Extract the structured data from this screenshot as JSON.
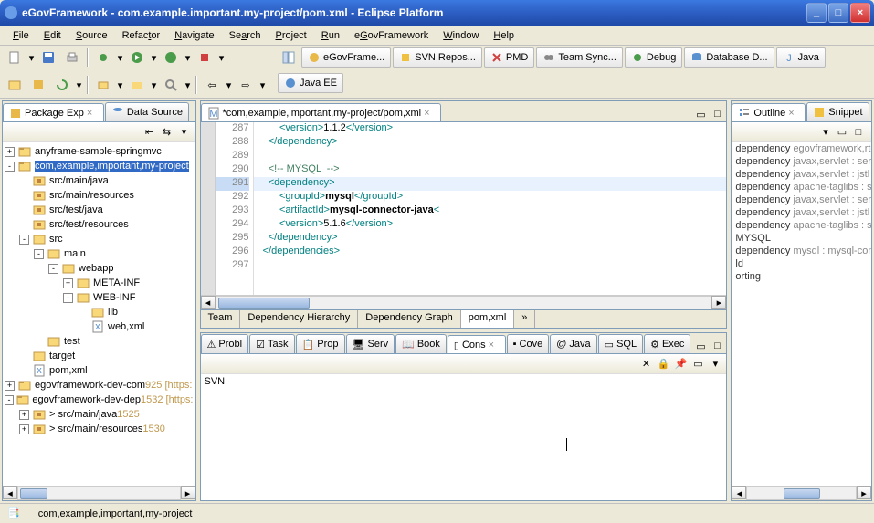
{
  "title": "eGovFramework - com.example.important.my-project/pom.xml - Eclipse Platform",
  "menu": [
    "File",
    "Edit",
    "Source",
    "Refactor",
    "Navigate",
    "Search",
    "Project",
    "Run",
    "eGovFramework",
    "Window",
    "Help"
  ],
  "perspectives": [
    "eGovFrame...",
    "SVN Repos...",
    "PMD",
    "Team Sync...",
    "Debug",
    "Database D...",
    "Java",
    "Java EE"
  ],
  "package_explorer": {
    "tab1": "Package Exp",
    "tab2": "Data Source",
    "tree": [
      {
        "indent": 0,
        "toggle": "+",
        "icon": "project",
        "label": "anyframe-sample-springmvc"
      },
      {
        "indent": 0,
        "toggle": "-",
        "icon": "project",
        "label": "com,example,important,my-project",
        "selected": true
      },
      {
        "indent": 1,
        "toggle": "",
        "icon": "pkg-folder",
        "label": "src/main/java"
      },
      {
        "indent": 1,
        "toggle": "",
        "icon": "pkg-folder",
        "label": "src/main/resources"
      },
      {
        "indent": 1,
        "toggle": "",
        "icon": "pkg-folder",
        "label": "src/test/java"
      },
      {
        "indent": 1,
        "toggle": "",
        "icon": "pkg-folder",
        "label": "src/test/resources"
      },
      {
        "indent": 1,
        "toggle": "-",
        "icon": "folder",
        "label": "src"
      },
      {
        "indent": 2,
        "toggle": "-",
        "icon": "folder",
        "label": "main"
      },
      {
        "indent": 3,
        "toggle": "-",
        "icon": "folder",
        "label": "webapp"
      },
      {
        "indent": 4,
        "toggle": "+",
        "icon": "folder",
        "label": "META-INF"
      },
      {
        "indent": 4,
        "toggle": "-",
        "icon": "folder",
        "label": "WEB-INF"
      },
      {
        "indent": 5,
        "toggle": "",
        "icon": "folder",
        "label": "lib"
      },
      {
        "indent": 5,
        "toggle": "",
        "icon": "xml",
        "label": "web,xml"
      },
      {
        "indent": 2,
        "toggle": "",
        "icon": "folder",
        "label": "test"
      },
      {
        "indent": 1,
        "toggle": "",
        "icon": "folder",
        "label": "target"
      },
      {
        "indent": 1,
        "toggle": "",
        "icon": "xml",
        "label": "pom,xml"
      },
      {
        "indent": 0,
        "toggle": "+",
        "icon": "project",
        "label": "egovframework-dev-com",
        "suffix": "925 [https:"
      },
      {
        "indent": 0,
        "toggle": "-",
        "icon": "project",
        "label": "egovframework-dev-dep",
        "suffix": "1532 [https:"
      },
      {
        "indent": 1,
        "toggle": "+",
        "icon": "pkg-folder",
        "label": "> src/main/java",
        "suffix": "1525"
      },
      {
        "indent": 1,
        "toggle": "+",
        "icon": "pkg-folder",
        "label": "> src/main/resources",
        "suffix": "1530"
      }
    ]
  },
  "editor": {
    "tab": "*com,example,important,my-project/pom,xml",
    "lines": [
      {
        "num": 287,
        "html": "        <span class='xml-tag'>&lt;version&gt;</span>1.1.2<span class='xml-tag'>&lt;/version&gt;</span>"
      },
      {
        "num": 288,
        "html": "    <span class='xml-tag'>&lt;/dependency&gt;</span>"
      },
      {
        "num": 289,
        "html": ""
      },
      {
        "num": 290,
        "html": "    <span class='xml-comment'>&lt;!-- MYSQL  --&gt;</span>"
      },
      {
        "num": 291,
        "html": "    <span class='xml-tag'>&lt;dependency&gt;</span>",
        "highlight": true
      },
      {
        "num": 292,
        "html": "        <span class='xml-tag'>&lt;groupId&gt;</span><b>mysql</b><span class='xml-tag'>&lt;/groupId&gt;</span>"
      },
      {
        "num": 293,
        "html": "        <span class='xml-tag'>&lt;artifactId&gt;</span><b>mysql-connector-java</b><span class='xml-tag'>&lt;</span>"
      },
      {
        "num": 294,
        "html": "        <span class='xml-tag'>&lt;version&gt;</span>5.1.6<span class='xml-tag'>&lt;/version&gt;</span>"
      },
      {
        "num": 295,
        "html": "    <span class='xml-tag'>&lt;/dependency&gt;</span>"
      },
      {
        "num": 296,
        "html": "  <span class='xml-tag'>&lt;/dependencies&gt;</span>"
      },
      {
        "num": 297,
        "html": ""
      }
    ],
    "bottom_tabs": [
      "Team",
      "Dependency Hierarchy",
      "Dependency Graph",
      "pom,xml"
    ],
    "active_bottom": "pom,xml"
  },
  "outline": {
    "tab1": "Outline",
    "tab2": "Snippet",
    "rows": [
      {
        "k": "dependency",
        "v": "egovframework,rte :"
      },
      {
        "k": "dependency",
        "v": "javax,servlet : servle"
      },
      {
        "k": "dependency",
        "v": "javax,servlet : jstl :"
      },
      {
        "k": "dependency",
        "v": "apache-taglibs : sta"
      },
      {
        "k": "dependency",
        "v": "javax,servlet : servle"
      },
      {
        "k": "dependency",
        "v": "javax,servlet : jstl :"
      },
      {
        "k": "dependency",
        "v": "apache-taglibs : sta"
      },
      {
        "k": "MYSQL",
        "v": ""
      },
      {
        "k": "dependency",
        "v": "mysql : mysql-conn"
      },
      {
        "k": "ld",
        "v": ""
      },
      {
        "k": "orting",
        "v": ""
      }
    ]
  },
  "console": {
    "tabs": [
      "Probl",
      "Task",
      "Prop",
      "Serv",
      "Book",
      "Cons",
      "Cove",
      "Java",
      "SQL",
      "Exec"
    ],
    "active": "Cons",
    "body": "SVN"
  },
  "statusbar": {
    "selection": "com,example,important,my-project"
  }
}
